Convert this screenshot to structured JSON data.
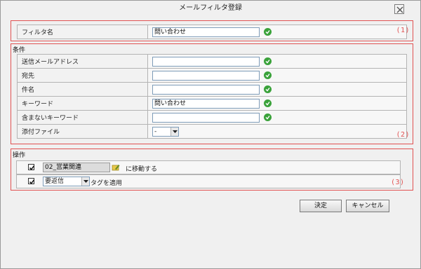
{
  "dialog": {
    "title": "メールフィルタ登録"
  },
  "section1": {
    "marker": "(1)",
    "rows": [
      {
        "label": "フィルタ名",
        "value": "問い合わせ"
      }
    ]
  },
  "section2": {
    "title": "条件",
    "marker": "(2)",
    "rows": [
      {
        "label": "送信メールアドレス",
        "value": ""
      },
      {
        "label": "宛先",
        "value": ""
      },
      {
        "label": "件名",
        "value": ""
      },
      {
        "label": "キーワード",
        "value": "問い合わせ"
      },
      {
        "label": "含まないキーワード",
        "value": ""
      }
    ],
    "attachment": {
      "label": "添付ファイル",
      "value": "-"
    }
  },
  "section3": {
    "title": "操作",
    "marker": "(3)",
    "move": {
      "folder": "02_営業関連",
      "text": "に移動する"
    },
    "tag": {
      "value": "要返信",
      "text": "タグを適用"
    }
  },
  "buttons": {
    "ok": "決定",
    "cancel": "キャンセル"
  },
  "colors": {
    "accent": "#e15252",
    "ok_icon": "#3aa23a"
  }
}
